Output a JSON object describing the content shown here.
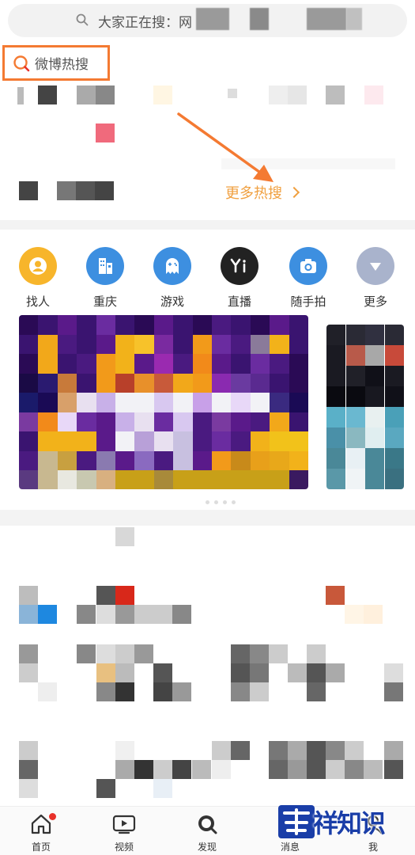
{
  "search": {
    "text": "大家正在搜：网"
  },
  "hot_search": {
    "label": "微博热搜",
    "more_label": "更多热搜"
  },
  "quick_icons": [
    {
      "label": "找人",
      "icon": "person-icon",
      "color": "#f7b52b"
    },
    {
      "label": "重庆",
      "icon": "city-building-icon",
      "color": "#3d8fe0"
    },
    {
      "label": "游戏",
      "icon": "game-ghost-icon",
      "color": "#3d8fe0"
    },
    {
      "label": "直播",
      "icon": "yi-live-icon",
      "color": "#222222"
    },
    {
      "label": "随手拍",
      "icon": "camera-icon",
      "color": "#3d8fe0"
    },
    {
      "label": "更多",
      "icon": "chevron-down-icon",
      "color": "#a9b3cc"
    }
  ],
  "bottom_nav": [
    {
      "label": "首页",
      "icon": "home-icon",
      "badge": true
    },
    {
      "label": "视频",
      "icon": "video-icon",
      "badge": false
    },
    {
      "label": "发现",
      "icon": "discover-icon",
      "badge": false
    },
    {
      "label": "消息",
      "icon": "message-icon",
      "badge": false
    },
    {
      "label": "我",
      "icon": "profile-icon",
      "badge": false
    }
  ],
  "watermark": {
    "text": "祥知识"
  },
  "colors": {
    "accent_orange": "#f47a32",
    "hot_more": "#f0a040",
    "badge_red": "#e8312a"
  }
}
